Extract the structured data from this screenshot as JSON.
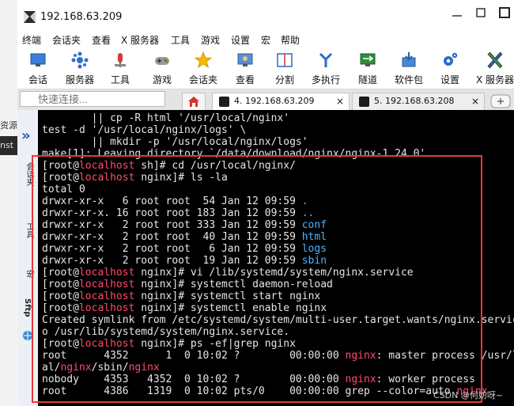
{
  "background": {
    "left_text_1": "资源",
    "left_text_2": "nst"
  },
  "window": {
    "title": "192.168.63.209"
  },
  "menu": [
    "终端",
    "会话夹",
    "查看",
    "X 服务器",
    "工具",
    "游戏",
    "设置",
    "宏",
    "帮助"
  ],
  "toolbar": [
    {
      "label": "会话",
      "icon": "session-monitor-icon"
    },
    {
      "label": "服务器",
      "icon": "servers-icon"
    },
    {
      "label": "工具",
      "icon": "tools-icon"
    },
    {
      "label": "游戏",
      "icon": "gamepad-icon"
    },
    {
      "label": "会话夹",
      "icon": "star-icon"
    },
    {
      "label": "查看",
      "icon": "view-icon"
    },
    {
      "label": "分割",
      "icon": "split-icon"
    },
    {
      "label": "多执行",
      "icon": "multi-exec-icon"
    },
    {
      "label": "隧道",
      "icon": "tunnel-icon"
    },
    {
      "label": "软件包",
      "icon": "package-icon"
    },
    {
      "label": "设置",
      "icon": "settings-gear-icon"
    },
    {
      "label": "X 服务器",
      "icon": "x-server-icon"
    }
  ],
  "quick_connect": {
    "placeholder": "快速连接..."
  },
  "tabs": [
    {
      "label": "4. 192.168.63.209",
      "close": "×",
      "active": true
    },
    {
      "label": "5. 192.168.63.208",
      "close": "×",
      "active": false
    }
  ],
  "side_panel": {
    "arrow": "»",
    "labels": [
      "会话夹",
      "工具",
      "宏",
      "Sftp"
    ]
  },
  "terminal": {
    "lines": [
      [
        {
          "t": "        || cp -R html '/usr/local/nginx'"
        }
      ],
      [
        {
          "t": "test -d '/usr/local/nginx/logs' \\"
        }
      ],
      [
        {
          "t": "        || mkdir -p '/usr/local/nginx/logs'"
        }
      ],
      [
        {
          "t": "make[1]: Leaving directory `/data/download/nginx/nginx-1.24.0'"
        }
      ],
      [
        {
          "t": "[root@"
        },
        {
          "t": "localhost",
          "c": "host"
        },
        {
          "t": " sh]# cd /usr/local/nginx/"
        }
      ],
      [
        {
          "t": "[root@"
        },
        {
          "t": "localhost",
          "c": "host"
        },
        {
          "t": " nginx]# ls -la"
        }
      ],
      [
        {
          "t": "total 0"
        }
      ],
      [
        {
          "t": "drwxr-xr-x   6 root root  54 Jan 12 09:59 "
        },
        {
          "t": ".",
          "c": "dir"
        }
      ],
      [
        {
          "t": "drwxr-xr-x. 16 root root 183 Jan 12 09:59 "
        },
        {
          "t": "..",
          "c": "dir"
        }
      ],
      [
        {
          "t": "drwxr-xr-x   2 root root 333 Jan 12 09:59 "
        },
        {
          "t": "conf",
          "c": "dir"
        }
      ],
      [
        {
          "t": "drwxr-xr-x   2 root root  40 Jan 12 09:59 "
        },
        {
          "t": "html",
          "c": "dir"
        }
      ],
      [
        {
          "t": "drwxr-xr-x   2 root root   6 Jan 12 09:59 "
        },
        {
          "t": "logs",
          "c": "dir"
        }
      ],
      [
        {
          "t": "drwxr-xr-x   2 root root  19 Jan 12 09:59 "
        },
        {
          "t": "sbin",
          "c": "dir"
        }
      ],
      [
        {
          "t": "[root@"
        },
        {
          "t": "localhost",
          "c": "host"
        },
        {
          "t": " nginx]# vi /lib/systemd/system/nginx.service"
        }
      ],
      [
        {
          "t": "[root@"
        },
        {
          "t": "localhost",
          "c": "host"
        },
        {
          "t": " nginx]# systemctl daemon-reload"
        }
      ],
      [
        {
          "t": "[root@"
        },
        {
          "t": "localhost",
          "c": "host"
        },
        {
          "t": " nginx]# systemctl start nginx"
        }
      ],
      [
        {
          "t": "[root@"
        },
        {
          "t": "localhost",
          "c": "host"
        },
        {
          "t": " nginx]# systemctl enable nginx"
        }
      ],
      [
        {
          "t": "Created symlink from /etc/systemd/system/multi-user.target.wants/nginx.service t"
        }
      ],
      [
        {
          "t": "o /usr/lib/systemd/system/nginx.service."
        }
      ],
      [
        {
          "t": "[root@"
        },
        {
          "t": "localhost",
          "c": "host"
        },
        {
          "t": " nginx]# ps -ef|grep nginx"
        }
      ],
      [
        {
          "t": "root      4352      1  0 10:02 ?        00:00:00 "
        },
        {
          "t": "nginx",
          "c": "red"
        },
        {
          "t": ": master process /usr/loc"
        }
      ],
      [
        {
          "t": "al/"
        },
        {
          "t": "nginx",
          "c": "red"
        },
        {
          "t": "/sbin/"
        },
        {
          "t": "nginx",
          "c": "red"
        }
      ],
      [
        {
          "t": "nobody    4353   4352  0 10:02 ?        00:00:00 "
        },
        {
          "t": "nginx",
          "c": "red"
        },
        {
          "t": ": worker process"
        }
      ],
      [
        {
          "t": "root      4386   1319  0 10:02 pts/0    00:00:00 grep --color=auto "
        },
        {
          "t": "nginx",
          "c": "red"
        }
      ]
    ]
  },
  "watermark": "CSDN @何妨呀~"
}
